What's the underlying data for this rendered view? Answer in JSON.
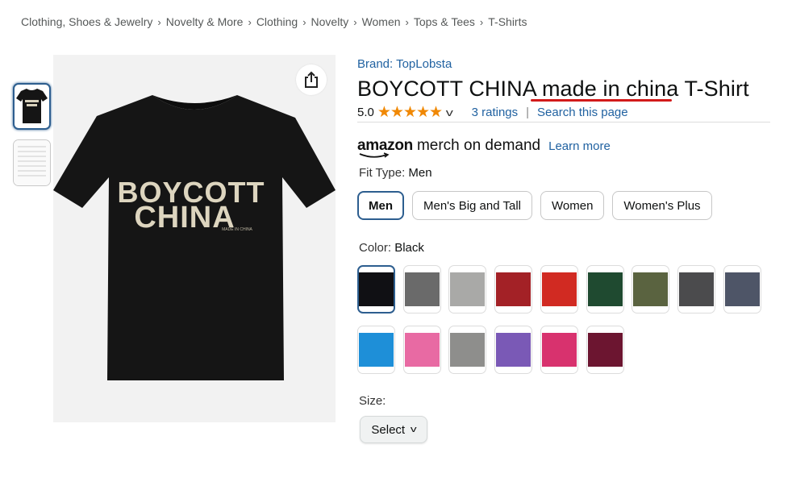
{
  "breadcrumb": [
    "Clothing, Shoes & Jewelry",
    "Novelty & More",
    "Clothing",
    "Novelty",
    "Women",
    "Tops & Tees",
    "T-Shirts"
  ],
  "breadcrumb_separator": "›",
  "product": {
    "brand": "Brand: TopLobsta",
    "title_prefix": "BOYCOTT CHINA ",
    "title_highlight": "made in china",
    "title_suffix": " T-Shirt",
    "shirt_print_line1": "BOYCOTT",
    "shirt_print_line2": "CHINA",
    "shirt_print_small": "MADE IN CHINA",
    "shirt_color": "#151515",
    "highlight_underline_color": "#d21a1a"
  },
  "rating": {
    "value": "5.0",
    "stars": 5,
    "ratings_link": "3 ratings",
    "search_link": "Search this page"
  },
  "merch": {
    "amazon": "amazon",
    "tagline": "merch on demand",
    "learn_more": "Learn more"
  },
  "fit": {
    "label": "Fit Type: ",
    "selected": "Men",
    "options": [
      "Men",
      "Men's Big and Tall",
      "Women",
      "Women's Plus"
    ]
  },
  "color": {
    "label": "Color: ",
    "selected": "Black",
    "swatches": [
      "#101014",
      "#6a6a6a",
      "#a9a9a7",
      "#a32126",
      "#d12a22",
      "#1f4a30",
      "#5a6340",
      "#4b4b4d",
      "#4e5567",
      "#1e8fd8",
      "#e86aa3",
      "#8e8e8c",
      "#7a59b6",
      "#d8326e",
      "#6c1530"
    ]
  },
  "size": {
    "label": "Size:",
    "select_label": "Select"
  },
  "icons": {
    "share": "share-icon",
    "chevron": "chevron-down-icon",
    "star": "star-icon"
  }
}
